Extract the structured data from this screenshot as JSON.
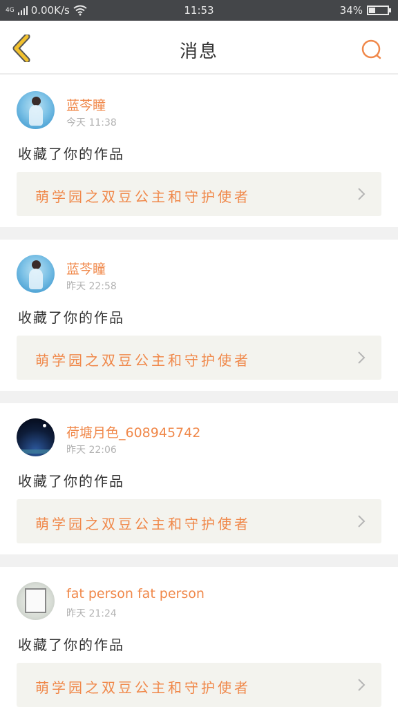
{
  "status_bar": {
    "network": "4G",
    "speed": "0.00K/s",
    "time": "11:53",
    "battery": "34%",
    "battery_level": 0.34
  },
  "header": {
    "title": "消息",
    "back_icon": "chevron-left-icon",
    "search_icon": "search-icon"
  },
  "colors": {
    "accent": "#f0884a",
    "back_icon": "#f2c12e",
    "card_bg": "#f3f3ee",
    "separator": "#f1f1f1"
  },
  "messages": [
    {
      "username": "蓝芩瞳",
      "time": "今天 11:38",
      "action": "收藏了你的作品",
      "work_title": "萌学园之双豆公主和守护使者"
    },
    {
      "username": "蓝芩瞳",
      "time": "昨天 22:58",
      "action": "收藏了你的作品",
      "work_title": "萌学园之双豆公主和守护使者"
    },
    {
      "username": "荷塘月色_608945742",
      "time": "昨天 22:06",
      "action": "收藏了你的作品",
      "work_title": "萌学园之双豆公主和守护使者"
    },
    {
      "username": "fat person fat person",
      "time": "昨天 21:24",
      "action": "收藏了你的作品",
      "work_title": "萌学园之双豆公主和守护使者"
    }
  ]
}
